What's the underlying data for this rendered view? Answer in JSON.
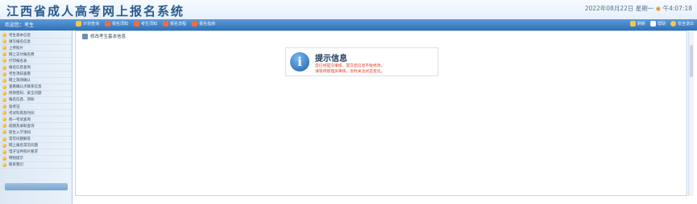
{
  "header": {
    "site_title": "江西省成人高考网上报名系统",
    "datetime": "2022年08月22日 星期一",
    "clock_icon": "clock-icon",
    "time": "午4:07:18"
  },
  "toolbar": {
    "user_tag": "欢迎您：考生",
    "left_items": [
      {
        "label": "计划查询",
        "color": "#f4c64a",
        "icon": "plan-icon"
      },
      {
        "label": "报名须知",
        "color": "#ef6d3c",
        "icon": "notice-icon"
      },
      {
        "label": "考生须知",
        "color": "#ef6d3c",
        "icon": "candidate-icon"
      },
      {
        "label": "报名流程",
        "color": "#ef6d3c",
        "icon": "flow-icon"
      },
      {
        "label": "报名指南",
        "color": "#ef6d3c",
        "icon": "guide-icon"
      }
    ],
    "right_items": [
      {
        "label": "刷新",
        "color": "#f4c64a",
        "icon": "refresh-icon"
      },
      {
        "label": "帮助",
        "color": "#ffffff",
        "icon": "help-icon"
      },
      {
        "label": "安全退出",
        "color": "#f4c64a",
        "icon": "logout-icon"
      }
    ]
  },
  "sidebar": {
    "items": [
      {
        "label": "考生基本信息"
      },
      {
        "label": "填写报名信息"
      },
      {
        "label": "上传照片"
      },
      {
        "label": "网上支付报名费"
      },
      {
        "label": "打印报名表"
      },
      {
        "label": "报名信息查询"
      },
      {
        "label": "考生须知查看"
      },
      {
        "label": "网上现场确认"
      },
      {
        "label": "查看确认点联系信息"
      },
      {
        "label": "修改密码、安全问题"
      },
      {
        "label": "报名信息、须知"
      },
      {
        "label": "准考证"
      },
      {
        "label": "考试科目及时间"
      },
      {
        "label": "统一考试查询"
      },
      {
        "label": "成绩及录取查询"
      },
      {
        "label": "新生入学须知"
      },
      {
        "label": "常见问题解答"
      },
      {
        "label": "网上报名常见问题"
      },
      {
        "label": "电子证件照片要求"
      },
      {
        "label": "特别提示"
      },
      {
        "label": "联系我们"
      }
    ]
  },
  "main": {
    "page_heading": "修改考生基本信息",
    "notice": {
      "title": "提示信息",
      "line1": "您已经提交审核，提交后信息不能修改。",
      "line2": "请等待管理员审核，及时关注状态变化。"
    }
  }
}
